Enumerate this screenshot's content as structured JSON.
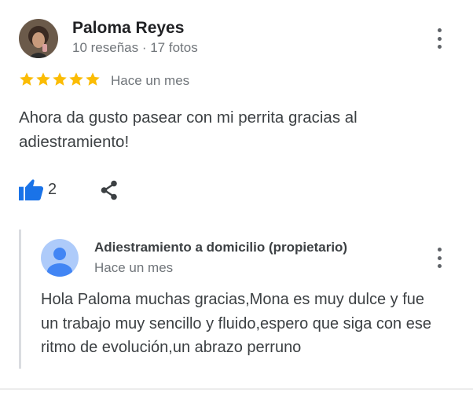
{
  "review": {
    "reviewer_name": "Paloma Reyes",
    "reviewer_meta": "10 reseñas · 17 fotos",
    "rating": 5,
    "rating_max": 5,
    "time": "Hace un mes",
    "text": "Ahora da gusto pasear con mi perrita gracias al adiestramiento!",
    "likes": "2",
    "star_color": "#fbbc04",
    "like_icon": "thumbs-up-icon",
    "like_color": "#1a73e8",
    "share_icon": "share-icon",
    "menu_icon": "more-vert-icon"
  },
  "owner_reply": {
    "name": "Adiestramiento a domicilio (propietario)",
    "time": "Hace un mes",
    "text": "Hola Paloma muchas gracias,Mona es muy dulce y fue un trabajo muy sencillo y fluido,espero que siga con ese ritmo de evolución,un abrazo perruno",
    "avatar_icon": "default-user-avatar-icon",
    "avatar_color": "#aecbfa",
    "menu_icon": "more-vert-icon"
  }
}
